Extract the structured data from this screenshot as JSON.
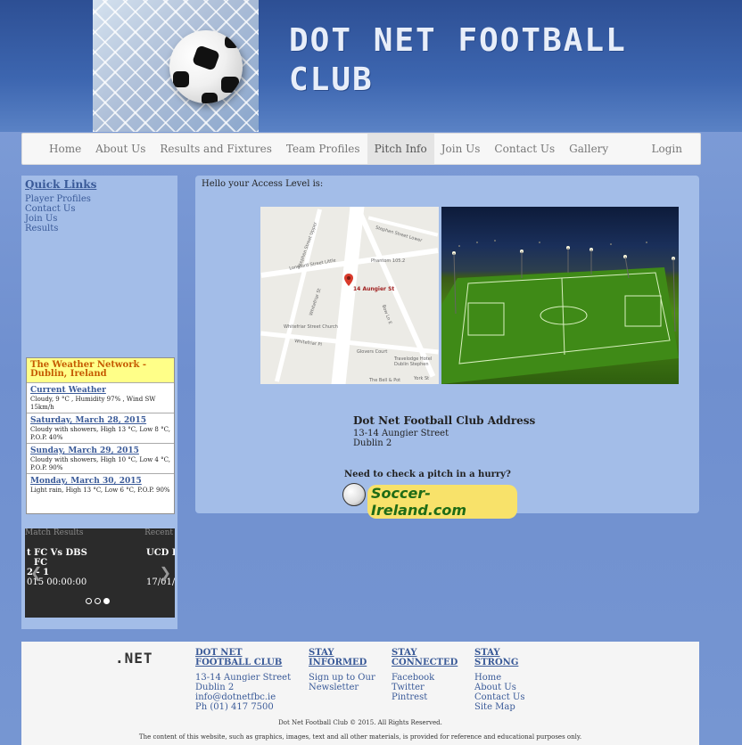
{
  "header": {
    "title_line1": "DOT NET FOOTBALL",
    "title_line2": "CLUB"
  },
  "nav": {
    "items": [
      {
        "label": "Home"
      },
      {
        "label": "About Us"
      },
      {
        "label": "Results and Fixtures"
      },
      {
        "label": "Team Profiles"
      },
      {
        "label": "Pitch Info"
      },
      {
        "label": "Join Us"
      },
      {
        "label": "Contact Us"
      },
      {
        "label": "Gallery"
      }
    ],
    "active": "Pitch Info",
    "login": "Login"
  },
  "sidebar": {
    "quick_links_title": "Quick Links",
    "links": [
      "Player Profiles",
      "Contact Us",
      "Join Us",
      "Results"
    ],
    "weather": {
      "title": "The Weather Network - Dublin, Ireland",
      "items": [
        {
          "day": "Current Weather",
          "desc": "Cloudy, 9 °C , Humidity 97% , Wind SW 15km/h"
        },
        {
          "day": "Saturday, March 28, 2015",
          "desc": "Cloudy with showers, High 13 °C, Low 8 °C, P.O.P. 40%"
        },
        {
          "day": "Sunday, March 29, 2015",
          "desc": "Cloudy with showers, High 10 °C, Low 4 °C, P.O.P. 90%"
        },
        {
          "day": "Monday, March 30, 2015",
          "desc": "Light rain, High 13 °C, Low 6 °C, P.O.P. 90%"
        }
      ]
    },
    "carousel": {
      "left_header": "Match Results",
      "right_header": "Recent",
      "slide1_line1": "t FC Vs DBS",
      "slide1_line2": "FC",
      "slide1_line3": "2 - 1",
      "slide1_line4": "015 00:00:00",
      "slide2_line1": "UCD F",
      "slide2_line4": "17/01/2"
    }
  },
  "main": {
    "greeting": "Hello your Access Level is:",
    "map": {
      "pin_label": "14 Aungier St",
      "street_labels": [
        "Stephen Street Upper",
        "Stephen Street Lower",
        "Longford Street Little",
        "Phantom 105.2",
        "Whitefriar St",
        "Bow Ln E",
        "Whitefriar Street Church",
        "Whitefriar Pl",
        "Glovers Court",
        "Travelodge Hotel Dublin Stephen",
        "York St",
        "The Bell & Pot"
      ]
    },
    "address_title": "Dot Net Football Club Address",
    "address_line1": "13-14 Aungier Street",
    "address_line2": "Dublin 2",
    "pitch_question": "Need to check a pitch in a hurry?",
    "soccer_ireland": "Soccer-Ireland.com"
  },
  "footer": {
    "logo": ".NET",
    "columns": [
      {
        "heading_line1": "DOT NET",
        "heading_line2": "FOOTBALL CLUB",
        "items": [
          "13-14 Aungier Street",
          "Dublin 2",
          "info@dotnetfbc.ie",
          "Ph (01) 417 7500"
        ]
      },
      {
        "heading_line1": "STAY",
        "heading_line2": "INFORMED",
        "items": [
          "Sign up to Our",
          "Newsletter"
        ]
      },
      {
        "heading_line1": "STAY",
        "heading_line2": "CONNECTED",
        "items": [
          "Facebook",
          "Twitter",
          "Pintrest"
        ]
      },
      {
        "heading_line1": "STAY",
        "heading_line2": "STRONG",
        "items": [
          "Home",
          "About Us",
          "Contact Us",
          "Site Map"
        ]
      }
    ],
    "copyright": "Dot Net Football Club © 2015. All Rights Reserved.",
    "disclaimer": "The content of this website, such as graphics, images, text and all other materials, is provided for reference and educational purposes only."
  },
  "colors": {
    "link": "#3a5a98",
    "panel": "#a3bde8",
    "header": "#2d4f94"
  }
}
